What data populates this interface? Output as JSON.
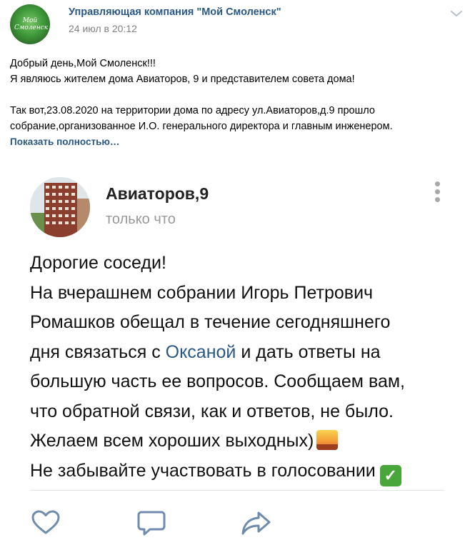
{
  "post": {
    "author": "Управляющая компания \"Мой Смоленск\"",
    "date": "24 июл в 20:12",
    "avatar_text": "Мой Смоленск",
    "text_lines": [
      "Добрый день,Мой Смоленск!!!",
      "Я являюсь жителем дома Авиаторов, 9 и представителем совета дома!",
      "",
      "Так вот,23.08.2020 на территории дома по адресу ул.Авиаторов,д.9 прошло",
      "собрание,организованное И.О. генерального директора и главным инженером."
    ],
    "show_more": "Показать полностью…"
  },
  "card": {
    "name": "Авиаторов,9",
    "time": "только что",
    "line1": "Дорогие соседи!",
    "line2": "На вчерашнем собрании Игорь Петрович",
    "line3": "Ромашков обещал в течение сегодняшнего",
    "line4_before": "дня связаться с ",
    "line4_mention": "Оксаной",
    "line4_after": " и дать ответы на",
    "line5": "большую часть ее вопросов. Сообщаем вам,",
    "line6": "что обратной связи, как и ответов, не было.",
    "line7": "Желаем всем хороших выходных)",
    "line8": "Не забывайте участвовать в голосовании"
  },
  "icons": {
    "menu": "chevron-down-icon",
    "like": "heart-icon",
    "comment": "comment-icon",
    "share": "share-icon"
  },
  "colors": {
    "link": "#2a5885",
    "muted": "#828282",
    "icon": "#6f8bad"
  }
}
